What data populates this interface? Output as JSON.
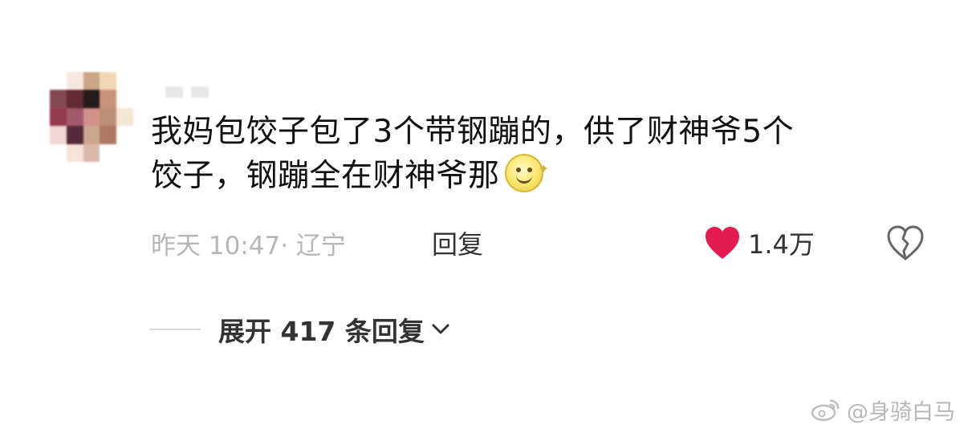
{
  "comment": {
    "line1": "我妈包饺子包了3个带钢蹦的，供了财神爷5个",
    "line2": "饺子，钢蹦全在财神爷那",
    "emoji": "smile-emoji"
  },
  "meta": {
    "time_location": "昨天 10:47· 辽宁",
    "reply": "回复",
    "likes": "1.4万"
  },
  "thread": {
    "expand_label": "展开 417 条回复"
  },
  "watermark": {
    "text": "@身骑白马"
  },
  "colors": {
    "heart": "#e31b4f",
    "muted": "#b6b6b6",
    "text": "#111111",
    "background": "#ffffff"
  },
  "icons": {
    "like": "heart-icon",
    "dislike": "broken-heart-icon",
    "chevron": "chevron-down-icon",
    "watermark": "weibo-logo-icon"
  }
}
